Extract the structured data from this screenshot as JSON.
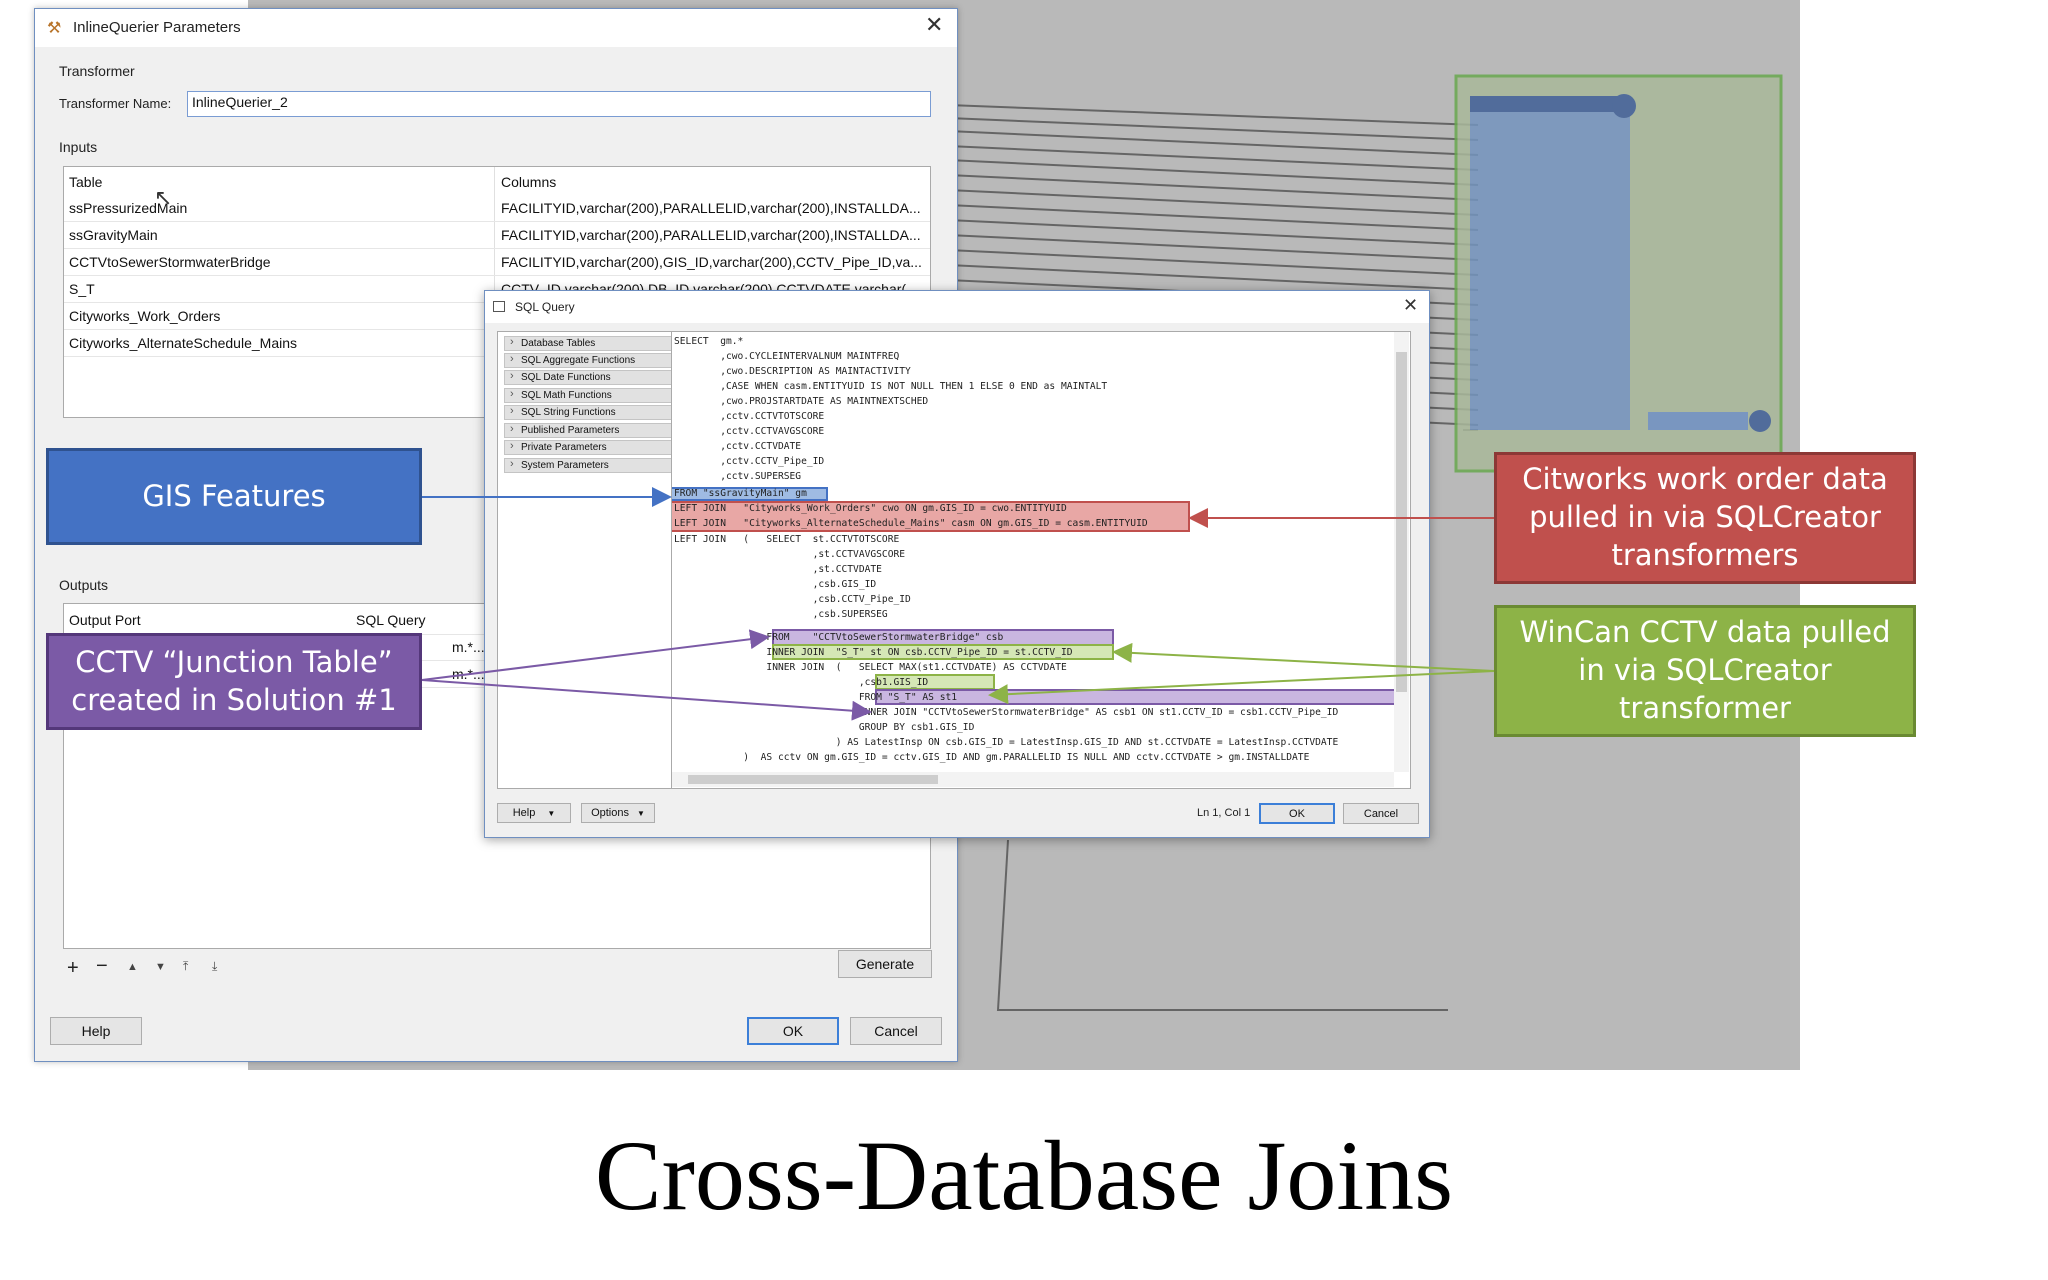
{
  "main_dialog": {
    "title": "InlineQuerier Parameters",
    "transformer_group": "Transformer",
    "transformer_name_label": "Transformer Name:",
    "transformer_name_value": "InlineQuerier_2",
    "inputs_group": "Inputs",
    "inputs_headers": [
      "Table",
      "Columns"
    ],
    "inputs_rows": [
      {
        "table": "ssPressurizedMain",
        "columns": "FACILITYID,varchar(200),PARALLELID,varchar(200),INSTALLDA..."
      },
      {
        "table": "ssGravityMain",
        "columns": "FACILITYID,varchar(200),PARALLELID,varchar(200),INSTALLDA..."
      },
      {
        "table": "CCTVtoSewerStormwaterBridge",
        "columns": "FACILITYID,varchar(200),GIS_ID,varchar(200),CCTV_Pipe_ID,va..."
      },
      {
        "table": "S_T",
        "columns": "CCTV_ID,varchar(200),DB_ID,varchar(200),CCTVDATE,varchar("
      },
      {
        "table": "Cityworks_Work_Orders",
        "columns": ""
      },
      {
        "table": "Cityworks_AlternateSchedule_Mains",
        "columns": ""
      }
    ],
    "outputs_group": "Outputs",
    "outputs_headers": [
      "Output Port",
      "SQL Query"
    ],
    "outputs_rows": [
      {
        "port": "",
        "query": "m.*... (Mu"
      },
      {
        "port": "",
        "query": "m.*... (Mu"
      }
    ],
    "generate_label": "Generate",
    "help_label": "Help",
    "ok_label": "OK",
    "cancel_label": "Cancel"
  },
  "sql_dialog": {
    "title": "SQL Query",
    "functions": [
      "Database Tables",
      "SQL Aggregate Functions",
      "SQL Date Functions",
      "SQL Math Functions",
      "SQL String Functions",
      "Published Parameters",
      "Private Parameters",
      "System Parameters"
    ],
    "code_lines": [
      "SELECT  gm.*",
      "        ,cwo.CYCLEINTERVALNUM MAINTFREQ",
      "        ,cwo.DESCRIPTION AS MAINTACTIVITY",
      "        ,CASE WHEN casm.ENTITYUID IS NOT NULL THEN 1 ELSE 0 END as MAINTALT",
      "        ,cwo.PROJSTARTDATE AS MAINTNEXTSCHED",
      "        ,cctv.CCTVTOTSCORE",
      "        ,cctv.CCTVAVGSCORE",
      "        ,cctv.CCTVDATE",
      "        ,cctv.CCTV_Pipe_ID",
      "        ,cctv.SUPERSEG",
      "FROM \"ssGravityMain\" gm",
      "LEFT JOIN   \"Cityworks_Work_Orders\" cwo ON gm.GIS_ID = cwo.ENTITYUID",
      "LEFT JOIN   \"Cityworks_AlternateSchedule_Mains\" casm ON gm.GIS_ID = casm.ENTITYUID",
      "LEFT JOIN   (   SELECT  st.CCTVTOTSCORE",
      "                        ,st.CCTVAVGSCORE",
      "                        ,st.CCTVDATE",
      "                        ,csb.GIS_ID",
      "                        ,csb.CCTV_Pipe_ID",
      "                        ,csb.SUPERSEG",
      "                FROM    \"CCTVtoSewerStormwaterBridge\" csb",
      "                INNER JOIN  \"S_T\" st ON csb.CCTV_Pipe_ID = st.CCTV_ID",
      "                INNER JOIN  (   SELECT MAX(st1.CCTVDATE) AS CCTVDATE",
      "                                ,csb1.GIS_ID",
      "                                FROM \"S_T\" AS st1",
      "                                INNER JOIN \"CCTVtoSewerStormwaterBridge\" AS csb1 ON st1.CCTV_ID = csb1.CCTV_Pipe_ID",
      "                                GROUP BY csb1.GIS_ID",
      "                            ) AS LatestInsp ON csb.GIS_ID = LatestInsp.GIS_ID AND st.CCTVDATE = LatestInsp.CCTVDATE",
      "            )  AS cctv ON gm.GIS_ID = cctv.GIS_ID AND gm.PARALLELID IS NULL AND cctv.CCTVDATE > gm.INSTALLDATE"
    ],
    "help_label": "Help",
    "options_label": "Options",
    "status": "Ln 1, Col 1",
    "ok_label": "OK",
    "cancel_label": "Cancel"
  },
  "callouts": {
    "gis": "GIS Features",
    "cctv_junction": "CCTV “Junction Table” created in Solution #1",
    "cityworks": "Citworks work order data pulled in via SQLCreator transformers",
    "wincan": "WinCan CCTV data pulled in via SQLCreator transformer"
  },
  "colors": {
    "gis": "#4472c4",
    "cityworks": "#c0504d",
    "wincan": "#8db347",
    "junction": "#7b5aa6"
  },
  "slide_title": "Cross-Database Joins"
}
